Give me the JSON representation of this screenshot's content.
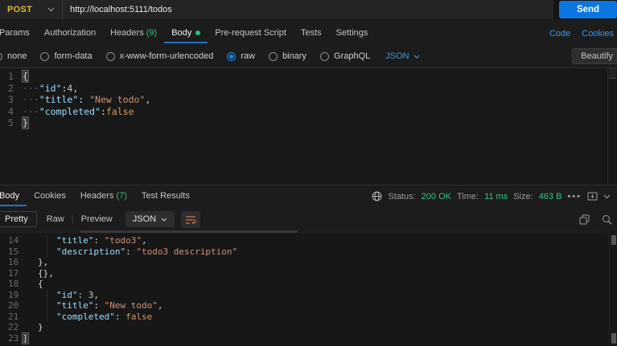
{
  "url_bar": {
    "method": "POST",
    "url": "http://localhost:5111/todos",
    "send": "Send"
  },
  "request_tabs": {
    "params": "Params",
    "authorization": "Authorization",
    "headers": "Headers",
    "headers_count": "(9)",
    "body": "Body",
    "pre_request": "Pre-request Script",
    "tests": "Tests",
    "settings": "Settings",
    "code": "Code",
    "cookies": "Cookies"
  },
  "body_options": {
    "none": "none",
    "form_data": "form-data",
    "urlencoded": "x-www-form-urlencoded",
    "raw": "raw",
    "binary": "binary",
    "graphql": "GraphQL",
    "content_type": "JSON",
    "beautify": "Beautify"
  },
  "request_editor": {
    "lines": [
      {
        "num": "1",
        "open": "{"
      },
      {
        "num": "2",
        "ws": "···",
        "key": "\"id\"",
        "colon": ":",
        "value": "4",
        "comma": ","
      },
      {
        "num": "3",
        "ws": "···",
        "key": "\"title\"",
        "colon": ": ",
        "value": "\"New todo\"",
        "comma": ","
      },
      {
        "num": "4",
        "ws": "···",
        "key": "\"completed\"",
        "colon": ":",
        "value": "false"
      },
      {
        "num": "5",
        "close": "}"
      }
    ]
  },
  "response_meta": {
    "tab_body": "Body",
    "tab_cookies": "Cookies",
    "tab_headers": "Headers",
    "headers_count": "(7)",
    "tab_test_results": "Test Results",
    "status_label": "Status:",
    "status_value": "200 OK",
    "time_label": "Time:",
    "time_value": "11 ms",
    "size_label": "Size:",
    "size_value": "463 B",
    "more_options": "•••"
  },
  "response_toolbar": {
    "pretty": "Pretty",
    "raw": "Raw",
    "preview": "Preview",
    "format": "JSON"
  },
  "response_editor": {
    "lines": [
      {
        "num": "14",
        "key": "\"title\"",
        "colon": ": ",
        "value": "\"todo3\"",
        "comma": ","
      },
      {
        "num": "15",
        "key": "\"description\"",
        "colon": ": ",
        "value": "\"todo3 description\""
      },
      {
        "num": "16",
        "plain": "},"
      },
      {
        "num": "17",
        "plain": "{},"
      },
      {
        "num": "18",
        "plain": "{"
      },
      {
        "num": "19",
        "key": "\"id\"",
        "colon": ": ",
        "value": "3",
        "comma": ","
      },
      {
        "num": "20",
        "key": "\"title\"",
        "colon": ": ",
        "value": "\"New todo\"",
        "comma": ","
      },
      {
        "num": "21",
        "key": "\"completed\"",
        "colon": ": ",
        "value": "false"
      },
      {
        "num": "22",
        "plain": "}"
      },
      {
        "num": "23",
        "close": "]"
      }
    ]
  },
  "colors": {
    "accent_blue": "#0b76e0",
    "method_yellow": "#e0b53e",
    "success_green": "#2ebd7b",
    "key_blue": "#9cdcfe",
    "string_orange": "#ce9178",
    "boolean_orange": "#d19a66",
    "wrap_icon_orange": "#c87550"
  }
}
